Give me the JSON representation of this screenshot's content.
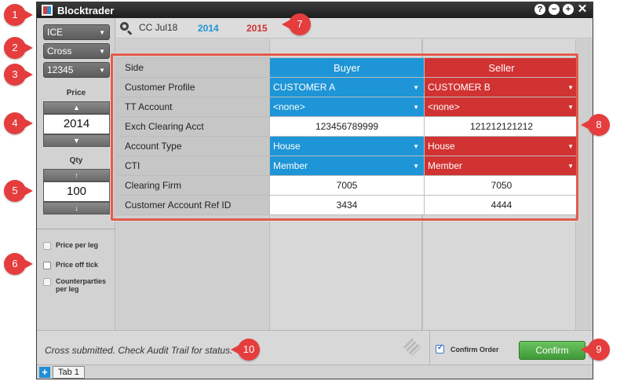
{
  "window": {
    "title": "Blocktrader",
    "controls": [
      "help",
      "minimize",
      "maximize",
      "close"
    ]
  },
  "left_panel": {
    "exchange": "ICE",
    "order_type": "Cross",
    "account": "12345",
    "price_label": "Price",
    "price_value": "2014",
    "qty_label": "Qty",
    "qty_value": "100",
    "options": [
      {
        "label": "Price per leg",
        "checked": false
      },
      {
        "label": "Price off tick",
        "checked": false
      },
      {
        "label": "Counterparties per leg",
        "checked": false
      }
    ]
  },
  "toolbar": {
    "contract": "CC Jul18",
    "buy_price": "2014",
    "sell_price": "2015"
  },
  "grid": {
    "columns": {
      "label": "Side",
      "buyer": "Buyer",
      "seller": "Seller"
    },
    "rows": [
      {
        "label": "Customer Profile",
        "buyer": "CUSTOMER A",
        "seller": "CUSTOMER B",
        "type": "select"
      },
      {
        "label": "TT Account",
        "buyer": "<none>",
        "seller": "<none>",
        "type": "select"
      },
      {
        "label": "Exch Clearing Acct",
        "buyer": "123456789999",
        "seller": "121212121212",
        "type": "text"
      },
      {
        "label": "Account Type",
        "buyer": "House",
        "seller": "House",
        "type": "select"
      },
      {
        "label": "CTI",
        "buyer": "Member",
        "seller": "Member",
        "type": "select"
      },
      {
        "label": "Clearing Firm",
        "buyer": "7005",
        "seller": "7050",
        "type": "text"
      },
      {
        "label": "Customer Account Ref ID",
        "buyer": "3434",
        "seller": "4444",
        "type": "text"
      }
    ]
  },
  "status": {
    "message": "Cross submitted. Check Audit Trail for status.",
    "confirm_order_label": "Confirm Order",
    "confirm_order_checked": true,
    "confirm_button": "Confirm"
  },
  "tabs": [
    {
      "label": "Tab 1"
    }
  ],
  "callouts": [
    "1",
    "2",
    "3",
    "4",
    "5",
    "6",
    "7",
    "8",
    "9",
    "10"
  ],
  "colors": {
    "buyer": "#1e95d6",
    "seller": "#d13232",
    "callout": "#e53d3d",
    "confirm": "#4aa83f"
  }
}
